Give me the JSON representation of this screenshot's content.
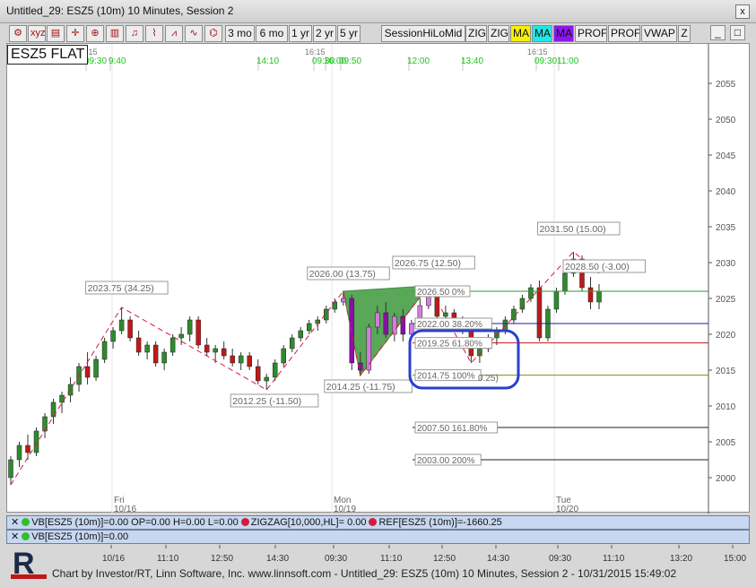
{
  "window": {
    "title": "Untitled_29: ESZ5 (10m) 10 Minutes, Session 2",
    "close_label": "x"
  },
  "toolbar": {
    "icon_buttons": [
      "chart-type-icon",
      "xyz-icon",
      "print-icon",
      "crosshair-icon",
      "zoom-icon",
      "bar-chart-icon",
      "alert-bell-icon",
      "line-chart-icon",
      "peaks-icon",
      "wave-icon"
    ],
    "text_buttons": [
      "3 mo",
      "6 mo",
      "1 yr",
      "2 yr",
      "5 yr",
      "SessionHiLoMid",
      "ZIG",
      "ZIG",
      "MA",
      "MA",
      "MA",
      "PROF",
      "PROF",
      "VWAP",
      "Z"
    ],
    "ma_colors": [
      "#f6f000",
      "#22e6e6",
      "#8a18e8"
    ],
    "window_buttons": [
      "_",
      "□",
      "×"
    ]
  },
  "symbol": "ESZ5 FLAT",
  "price_axis": {
    "ticks": [
      2055,
      2050,
      2045,
      2040,
      2035,
      2030,
      2025,
      2020,
      2015,
      2010,
      2005,
      2000
    ]
  },
  "time_axis": {
    "ticks": [
      "10/16",
      "11:10",
      "12:50",
      "14:30",
      "09:30",
      "11:10",
      "12:50",
      "14:30",
      "09:30",
      "11:10",
      "13:20",
      "15:00"
    ],
    "day_labels": [
      {
        "day": "Fri",
        "date": "10/16"
      },
      {
        "day": "Mon",
        "date": "10/19"
      },
      {
        "day": "Tue",
        "date": "10/20"
      }
    ]
  },
  "session_markers": [
    {
      "top": "16:15",
      "sub": "09:30"
    },
    {
      "top": "",
      "sub": "9:40"
    },
    {
      "top": "",
      "sub": "14:10"
    },
    {
      "top": "16:15",
      "sub": "09:30"
    },
    {
      "top": "",
      "sub": "16:00"
    },
    {
      "top": "",
      "sub": "09:50"
    },
    {
      "top": "",
      "sub": "12:00"
    },
    {
      "top": "",
      "sub": "13:40"
    },
    {
      "top": "16:15",
      "sub": "09:30"
    },
    {
      "top": "",
      "sub": "11:00"
    }
  ],
  "pivot_labels": [
    "2023.75 (34.25)",
    "2012.25 (-11.50)",
    "2026.00 (13.75)",
    "2014.25 (-11.75)",
    "2026.75 (12.50)",
    "2031.50 (15.00)",
    "2028.50 (-3.00)"
  ],
  "fib_levels": [
    {
      "label": "2026.50 0%",
      "price": 2026.0,
      "color": "#2e9a2e"
    },
    {
      "label": "2022.00 38.20%",
      "price": 2021.5,
      "color": "#1a1ab0"
    },
    {
      "label": "2019.25 61.80%",
      "price": 2018.8,
      "color": "#c01818"
    },
    {
      "label": "2014.75 100%",
      "price": 2014.3,
      "color": "#8a8a10"
    },
    {
      "label": "2007.50 161.80%",
      "price": 2007.0,
      "color": "#222222"
    },
    {
      "label": "2003.00 200%",
      "price": 2002.5,
      "color": "#222222"
    }
  ],
  "fib_extra_label": "0.25)",
  "studies": {
    "line1": [
      {
        "label": "VB[ESZ5 (10m)]=0.00 OP=0.00 H=0.00 L=0.00",
        "color": "#2fbf2f"
      },
      {
        "label": "ZIGZAG[10,000,HL]= 0.00",
        "color": "#d41b3a"
      },
      {
        "label": "REF[ESZ5 (10m)]=-1660.25",
        "color": "#d41b3a"
      }
    ],
    "line2": [
      {
        "label": "VB[ESZ5 (10m)]=0.00",
        "color": "#2fbf2f"
      }
    ]
  },
  "footer": "Chart by Investor/RT, Linn Software, Inc. www.linnsoft.com - Untitled_29: ESZ5 (10m) 10 Minutes, Session 2 - 10/31/2015 15:49:02",
  "logo_text": "R",
  "chart_data": {
    "type": "candlestick",
    "ylim": [
      1998,
      2058
    ],
    "price_labels_y": [
      2055,
      2050,
      2045,
      2040,
      2035,
      2030,
      2025,
      2020,
      2015,
      2010,
      2005,
      2000
    ],
    "candles": [
      [
        2000.0,
        2003.0,
        1999.0,
        2002.5
      ],
      [
        2002.5,
        2005.0,
        2001.5,
        2004.5
      ],
      [
        2004.5,
        2006.0,
        2002.5,
        2003.5
      ],
      [
        2003.5,
        2007.0,
        2003.0,
        2006.5
      ],
      [
        2006.5,
        2009.0,
        2005.5,
        2008.5
      ],
      [
        2008.5,
        2011.0,
        2007.5,
        2010.5
      ],
      [
        2010.5,
        2012.0,
        2009.0,
        2011.5
      ],
      [
        2011.5,
        2014.0,
        2010.5,
        2013.0
      ],
      [
        2013.0,
        2016.0,
        2012.0,
        2015.5
      ],
      [
        2015.5,
        2017.5,
        2013.0,
        2014.0
      ],
      [
        2014.0,
        2017.0,
        2013.5,
        2016.5
      ],
      [
        2016.5,
        2019.5,
        2016.0,
        2019.0
      ],
      [
        2019.0,
        2021.0,
        2018.0,
        2020.5
      ],
      [
        2020.5,
        2023.75,
        2020.0,
        2022.0
      ],
      [
        2022.0,
        2022.5,
        2019.0,
        2019.5
      ],
      [
        2019.5,
        2020.5,
        2017.0,
        2017.5
      ],
      [
        2017.5,
        2019.0,
        2016.5,
        2018.5
      ],
      [
        2018.5,
        2019.0,
        2015.5,
        2016.0
      ],
      [
        2016.0,
        2018.0,
        2015.0,
        2017.5
      ],
      [
        2017.5,
        2020.0,
        2017.0,
        2019.5
      ],
      [
        2019.5,
        2021.0,
        2018.5,
        2020.0
      ],
      [
        2020.0,
        2022.5,
        2019.0,
        2022.0
      ],
      [
        2022.0,
        2022.5,
        2018.0,
        2018.5
      ],
      [
        2018.5,
        2019.5,
        2017.0,
        2017.5
      ],
      [
        2017.5,
        2018.5,
        2016.0,
        2018.0
      ],
      [
        2018.0,
        2019.0,
        2016.5,
        2017.0
      ],
      [
        2017.0,
        2018.0,
        2015.5,
        2016.0
      ],
      [
        2016.0,
        2017.5,
        2015.0,
        2017.0
      ],
      [
        2017.0,
        2017.5,
        2015.0,
        2015.5
      ],
      [
        2015.5,
        2016.5,
        2013.0,
        2013.5
      ],
      [
        2013.5,
        2014.5,
        2012.25,
        2014.0
      ],
      [
        2014.0,
        2016.5,
        2013.5,
        2016.0
      ],
      [
        2016.0,
        2018.5,
        2015.5,
        2018.0
      ],
      [
        2018.0,
        2020.0,
        2017.5,
        2019.5
      ],
      [
        2019.5,
        2021.0,
        2019.0,
        2020.5
      ],
      [
        2020.5,
        2022.0,
        2020.0,
        2021.5
      ],
      [
        2021.5,
        2022.5,
        2020.5,
        2022.0
      ],
      [
        2022.0,
        2024.0,
        2021.5,
        2023.5
      ],
      [
        2023.5,
        2025.0,
        2023.0,
        2024.5
      ],
      [
        2024.5,
        2026.0,
        2024.0,
        2025.0
      ],
      [
        2025.0,
        2025.5,
        2015.0,
        2016.0
      ],
      [
        2016.0,
        2017.5,
        2014.25,
        2015.0
      ],
      [
        2015.0,
        2021.5,
        2014.5,
        2021.0
      ],
      [
        2021.0,
        2024.0,
        2020.0,
        2023.0
      ],
      [
        2023.0,
        2024.5,
        2019.5,
        2020.0
      ],
      [
        2020.0,
        2023.0,
        2019.0,
        2022.5
      ],
      [
        2022.5,
        2023.5,
        2019.0,
        2020.0
      ],
      [
        2020.0,
        2022.0,
        2019.5,
        2021.5
      ],
      [
        2021.5,
        2025.0,
        2021.0,
        2024.0
      ],
      [
        2024.0,
        2026.75,
        2023.5,
        2026.0
      ],
      [
        2026.0,
        2026.5,
        2022.0,
        2022.5
      ],
      [
        2022.5,
        2024.0,
        2021.5,
        2023.0
      ],
      [
        2023.0,
        2023.5,
        2021.0,
        2021.5
      ],
      [
        2021.5,
        2022.5,
        2020.0,
        2020.5
      ],
      [
        2020.5,
        2021.0,
        2016.0,
        2017.0
      ],
      [
        2017.0,
        2018.5,
        2016.0,
        2018.0
      ],
      [
        2018.0,
        2020.0,
        2017.5,
        2019.5
      ],
      [
        2019.5,
        2021.0,
        2018.5,
        2020.5
      ],
      [
        2020.5,
        2022.5,
        2020.0,
        2022.0
      ],
      [
        2022.0,
        2024.0,
        2021.5,
        2023.5
      ],
      [
        2023.5,
        2025.5,
        2023.0,
        2025.0
      ],
      [
        2025.0,
        2027.0,
        2024.5,
        2026.5
      ],
      [
        2026.5,
        2027.5,
        2019.0,
        2019.5
      ],
      [
        2019.5,
        2024.0,
        2019.0,
        2023.5
      ],
      [
        2023.5,
        2026.5,
        2023.0,
        2026.0
      ],
      [
        2026.0,
        2029.0,
        2025.5,
        2028.5
      ],
      [
        2028.5,
        2031.5,
        2028.0,
        2030.5
      ],
      [
        2030.5,
        2031.0,
        2026.0,
        2026.5
      ],
      [
        2026.5,
        2028.0,
        2023.5,
        2024.5
      ],
      [
        2024.5,
        2027.0,
        2023.5,
        2026.0
      ]
    ],
    "zigzag": [
      [
        0,
        1999.0
      ],
      [
        13,
        2023.75
      ],
      [
        30,
        2012.25
      ],
      [
        39,
        2026.0
      ],
      [
        41,
        2014.25
      ],
      [
        49,
        2026.75
      ],
      [
        54,
        2016.0
      ],
      [
        66,
        2031.5
      ],
      [
        69,
        2028.5
      ]
    ]
  }
}
